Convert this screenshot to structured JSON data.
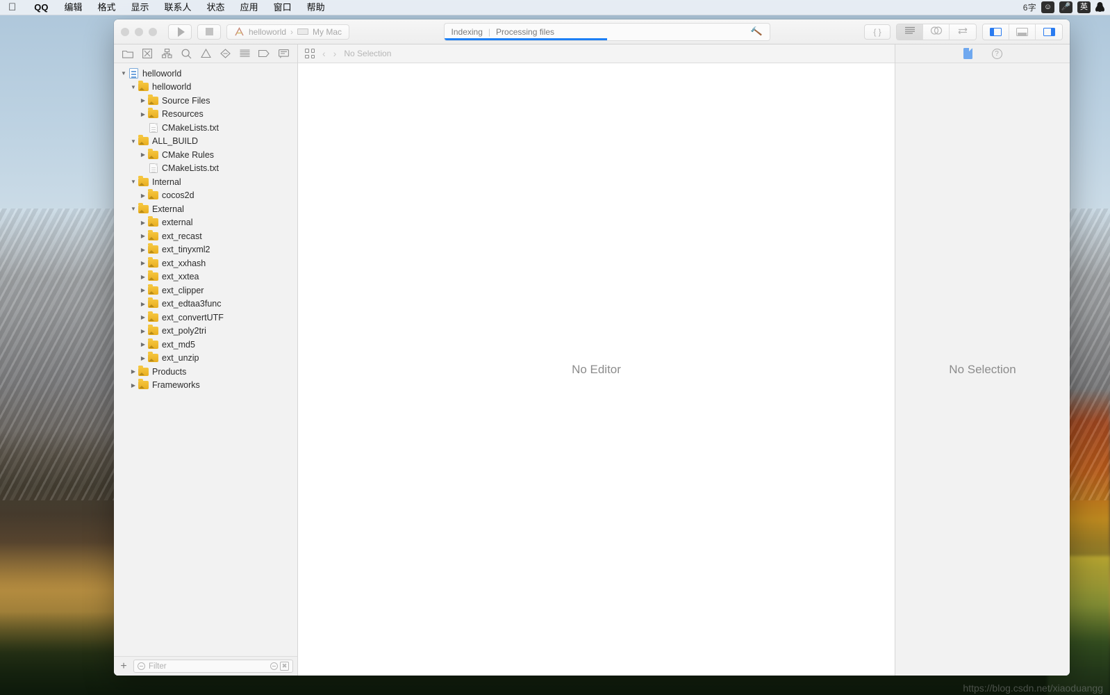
{
  "menubar": {
    "apple_icon": "apple-logo-icon",
    "items": [
      {
        "label": "QQ",
        "bold": true
      },
      {
        "label": "编辑",
        "bold": false
      },
      {
        "label": "格式",
        "bold": false
      },
      {
        "label": "显示",
        "bold": false
      },
      {
        "label": "联系人",
        "bold": false
      },
      {
        "label": "状态",
        "bold": false
      },
      {
        "label": "应用",
        "bold": false
      },
      {
        "label": "窗口",
        "bold": false
      },
      {
        "label": "帮助",
        "bold": false
      }
    ],
    "right": {
      "count": "6字",
      "emoji_icon": "smiley-face-icon",
      "mic_icon": "microphone-icon",
      "input_source": "英",
      "penguin_icon": "qq-penguin-icon"
    }
  },
  "toolbar": {
    "run_icon": "play-triangle-icon",
    "stop_icon": "stop-square-icon",
    "scheme": {
      "project": "helloworld",
      "separator": "›",
      "destination": "My Mac",
      "app_icon": "xcode-scheme-icon",
      "mac_icon": "mac-device-icon"
    },
    "status": {
      "primary": "Indexing",
      "separator": "|",
      "secondary": "Processing files",
      "progress_percent": 50,
      "activity_icon": "hammer-icon"
    },
    "editor_modes": {
      "code_icon": "braces-icon",
      "standard_icon": "standard-editor-icon",
      "assistant_icon": "assistant-editor-icon",
      "version_icon": "version-editor-icon",
      "active": "standard"
    },
    "view_toggles": {
      "navigator_icon": "left-panel-icon",
      "debug_icon": "bottom-panel-icon",
      "inspector_icon": "right-panel-icon",
      "navigator_on": true,
      "debug_on": false,
      "inspector_on": true
    },
    "accent_color": "#1d7ff5"
  },
  "navigator": {
    "tabs": [
      {
        "name": "project-navigator",
        "icon": "folder-icon"
      },
      {
        "name": "source-control-navigator",
        "icon": "source-control-icon"
      },
      {
        "name": "symbol-navigator",
        "icon": "hierarchy-icon"
      },
      {
        "name": "find-navigator",
        "icon": "search-icon"
      },
      {
        "name": "issue-navigator",
        "icon": "warning-triangle-icon"
      },
      {
        "name": "test-navigator",
        "icon": "diamond-icon"
      },
      {
        "name": "debug-navigator",
        "icon": "list-lines-icon"
      },
      {
        "name": "breakpoint-navigator",
        "icon": "breakpoint-tag-icon"
      },
      {
        "name": "report-navigator",
        "icon": "speech-bubble-icon"
      }
    ],
    "active_tab": 0,
    "tree": [
      {
        "label": "helloworld",
        "depth": 0,
        "icon": "project",
        "disclosure": "open"
      },
      {
        "label": "helloworld",
        "depth": 1,
        "icon": "folder",
        "disclosure": "open"
      },
      {
        "label": "Source Files",
        "depth": 2,
        "icon": "folder",
        "disclosure": "closed"
      },
      {
        "label": "Resources",
        "depth": 2,
        "icon": "folder",
        "disclosure": "closed"
      },
      {
        "label": "CMakeLists.txt",
        "depth": 2,
        "icon": "file",
        "disclosure": "none"
      },
      {
        "label": "ALL_BUILD",
        "depth": 1,
        "icon": "folder",
        "disclosure": "open"
      },
      {
        "label": "CMake Rules",
        "depth": 2,
        "icon": "folder",
        "disclosure": "closed"
      },
      {
        "label": "CMakeLists.txt",
        "depth": 2,
        "icon": "file",
        "disclosure": "none"
      },
      {
        "label": "Internal",
        "depth": 1,
        "icon": "folder",
        "disclosure": "open"
      },
      {
        "label": "cocos2d",
        "depth": 2,
        "icon": "folder",
        "disclosure": "closed"
      },
      {
        "label": "External",
        "depth": 1,
        "icon": "folder",
        "disclosure": "open"
      },
      {
        "label": "external",
        "depth": 2,
        "icon": "folder",
        "disclosure": "closed"
      },
      {
        "label": "ext_recast",
        "depth": 2,
        "icon": "folder",
        "disclosure": "closed"
      },
      {
        "label": "ext_tinyxml2",
        "depth": 2,
        "icon": "folder",
        "disclosure": "closed"
      },
      {
        "label": "ext_xxhash",
        "depth": 2,
        "icon": "folder",
        "disclosure": "closed"
      },
      {
        "label": "ext_xxtea",
        "depth": 2,
        "icon": "folder",
        "disclosure": "closed"
      },
      {
        "label": "ext_clipper",
        "depth": 2,
        "icon": "folder",
        "disclosure": "closed"
      },
      {
        "label": "ext_edtaa3func",
        "depth": 2,
        "icon": "folder",
        "disclosure": "closed"
      },
      {
        "label": "ext_convertUTF",
        "depth": 2,
        "icon": "folder",
        "disclosure": "closed"
      },
      {
        "label": "ext_poly2tri",
        "depth": 2,
        "icon": "folder",
        "disclosure": "closed"
      },
      {
        "label": "ext_md5",
        "depth": 2,
        "icon": "folder",
        "disclosure": "closed"
      },
      {
        "label": "ext_unzip",
        "depth": 2,
        "icon": "folder",
        "disclosure": "closed"
      },
      {
        "label": "Products",
        "depth": 1,
        "icon": "folder",
        "disclosure": "closed"
      },
      {
        "label": "Frameworks",
        "depth": 1,
        "icon": "folder",
        "disclosure": "closed"
      }
    ],
    "filter": {
      "add_label": "+",
      "placeholder": "Filter",
      "recent_icon": "clock-icon",
      "unsaved_icon": "source-control-filter-icon"
    }
  },
  "editor": {
    "jumpbar": {
      "related_icon": "related-items-icon",
      "back_icon": "chevron-left-icon",
      "forward_icon": "chevron-right-icon",
      "path": "No Selection"
    },
    "empty_message": "No Editor"
  },
  "inspector": {
    "tabs": [
      {
        "name": "file-inspector",
        "icon": "document-icon",
        "active": true
      },
      {
        "name": "quick-help-inspector",
        "icon": "question-mark-icon",
        "active": false
      }
    ],
    "empty_message": "No Selection"
  },
  "watermark": "https://blog.csdn.net/xiaoduangg"
}
